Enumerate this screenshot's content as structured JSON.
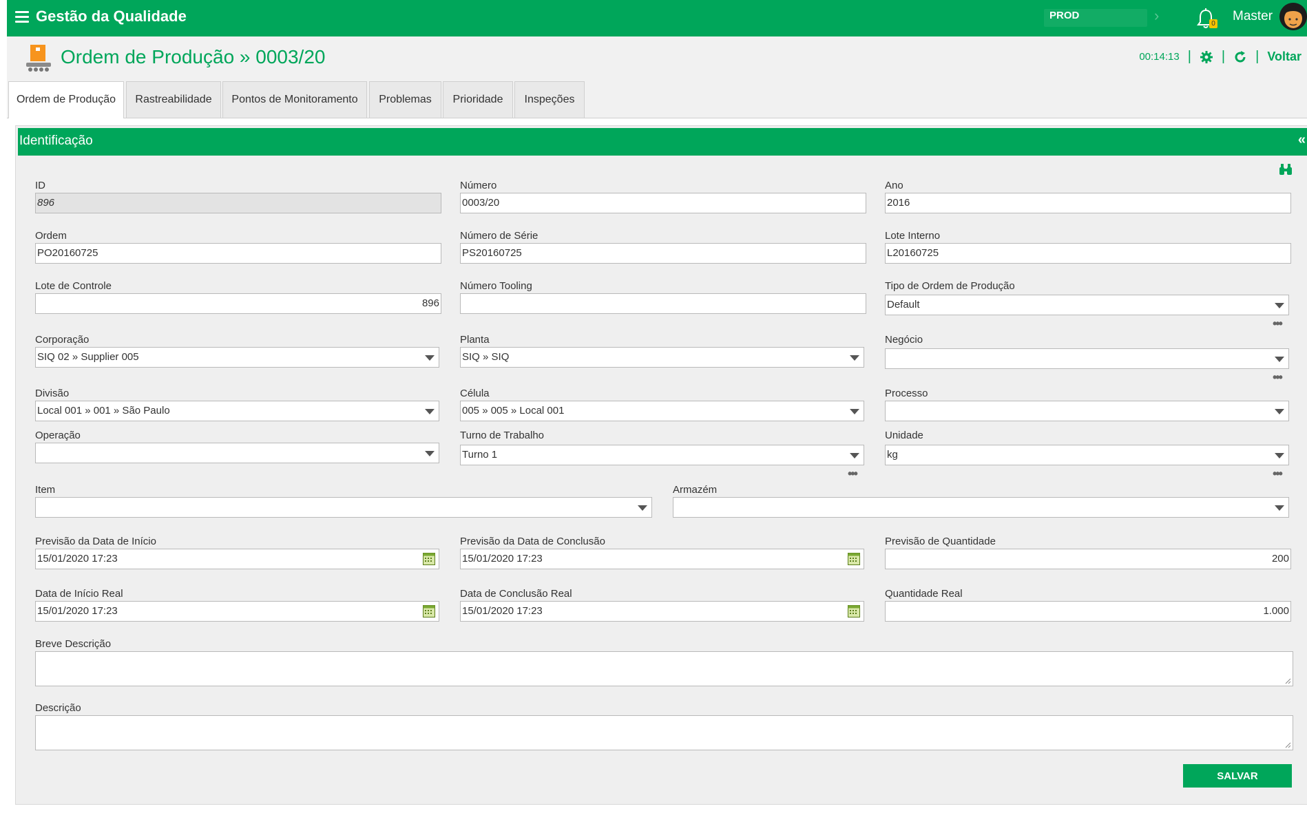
{
  "app": {
    "title": "Gestão da Qualidade",
    "environment": "PROD",
    "user": "Master",
    "notification_count": "0"
  },
  "header": {
    "title": "Ordem de Produção » 0003/20",
    "timer": "00:14:13",
    "back_label": "Voltar"
  },
  "tabs": [
    "Ordem de Produção",
    "Rastreabilidade",
    "Pontos de Monitoramento",
    "Problemas",
    "Prioridade",
    "Inspeções"
  ],
  "section": {
    "title": "Identificação",
    "collapse": "«"
  },
  "fields": {
    "id": {
      "label": "ID",
      "value": "896"
    },
    "numero": {
      "label": "Número",
      "value": "0003/20"
    },
    "ano": {
      "label": "Ano",
      "value": "2016"
    },
    "ordem": {
      "label": "Ordem",
      "value": "PO20160725"
    },
    "numero_serie": {
      "label": "Número de Série",
      "value": "PS20160725"
    },
    "lote_interno": {
      "label": "Lote Interno",
      "value": "L20160725"
    },
    "lote_controle": {
      "label": "Lote de Controle",
      "value": "896"
    },
    "numero_tooling": {
      "label": "Número Tooling",
      "value": ""
    },
    "tipo_ordem": {
      "label": "Tipo de Ordem de Produção",
      "value": "Default"
    },
    "corporacao": {
      "label": "Corporação",
      "value": "SIQ 02 » Supplier 005"
    },
    "planta": {
      "label": "Planta",
      "value": "SIQ » SIQ"
    },
    "negocio": {
      "label": "Negócio",
      "value": ""
    },
    "divisao": {
      "label": "Divisão",
      "value": "Local 001 » 001 » São Paulo"
    },
    "celula": {
      "label": "Célula",
      "value": "005 » 005 » Local 001"
    },
    "processo": {
      "label": "Processo",
      "value": ""
    },
    "operacao": {
      "label": "Operação",
      "value": ""
    },
    "turno": {
      "label": "Turno de Trabalho",
      "value": "Turno 1"
    },
    "unidade": {
      "label": "Unidade",
      "value": "kg"
    },
    "item": {
      "label": "Item",
      "value": ""
    },
    "armazem": {
      "label": "Armazém",
      "value": ""
    },
    "prev_inicio": {
      "label": "Previsão da Data de Início",
      "value": "15/01/2020 17:23"
    },
    "prev_conclusao": {
      "label": "Previsão da Data de Conclusão",
      "value": "15/01/2020 17:23"
    },
    "prev_quantidade": {
      "label": "Previsão de Quantidade",
      "value": "200"
    },
    "inicio_real": {
      "label": "Data de Início Real",
      "value": "15/01/2020 17:23"
    },
    "conclusao_real": {
      "label": "Data de Conclusão Real",
      "value": "15/01/2020 17:23"
    },
    "quantidade_real": {
      "label": "Quantidade Real",
      "value": "1.000"
    },
    "breve_descricao": {
      "label": "Breve Descrição",
      "value": ""
    },
    "descricao": {
      "label": "Descrição",
      "value": ""
    }
  },
  "actions": {
    "save_label": "SALVAR"
  },
  "colors": {
    "brand": "#00a65a",
    "badge": "#f5c400"
  }
}
